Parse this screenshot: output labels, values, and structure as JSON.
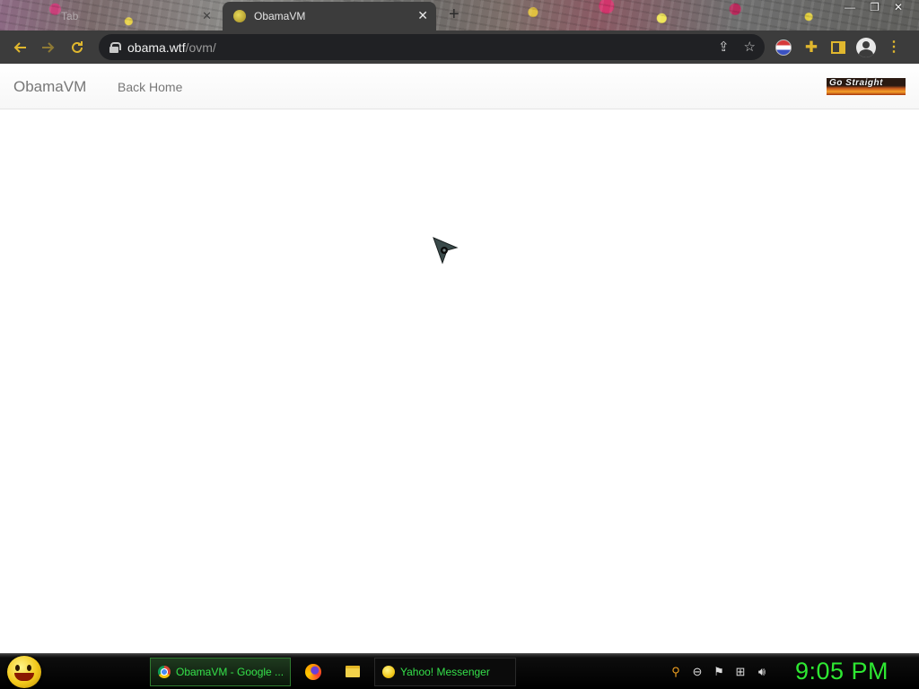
{
  "browser": {
    "tabs": [
      {
        "title": "Tab",
        "active": false
      },
      {
        "title": "ObamaVM",
        "active": true
      }
    ],
    "new_tab_symbol": "+",
    "window_controls": {
      "minimize": "—",
      "restore": "❐",
      "close": "✕"
    },
    "url_host": "obama.wtf",
    "url_path": "/ovm/",
    "accent_color": "#e0b72e",
    "icons": [
      "back-icon",
      "forward-icon",
      "reload-icon",
      "lock-icon",
      "share-icon",
      "star-icon",
      "extension-flag-icon",
      "puzzle-icon",
      "side-panel-icon",
      "profile-icon",
      "menu-icon"
    ]
  },
  "page": {
    "brand": "ObamaVM",
    "nav_link": "Back Home",
    "banner_text": "Go Straight"
  },
  "taskbar": {
    "tasks": [
      {
        "label": "ObamaVM - Google ...",
        "active": true
      },
      {
        "label": "Yahoo! Messenger",
        "active": false
      }
    ],
    "clock": "9:05 PM",
    "clock_color": "#2ee832"
  }
}
